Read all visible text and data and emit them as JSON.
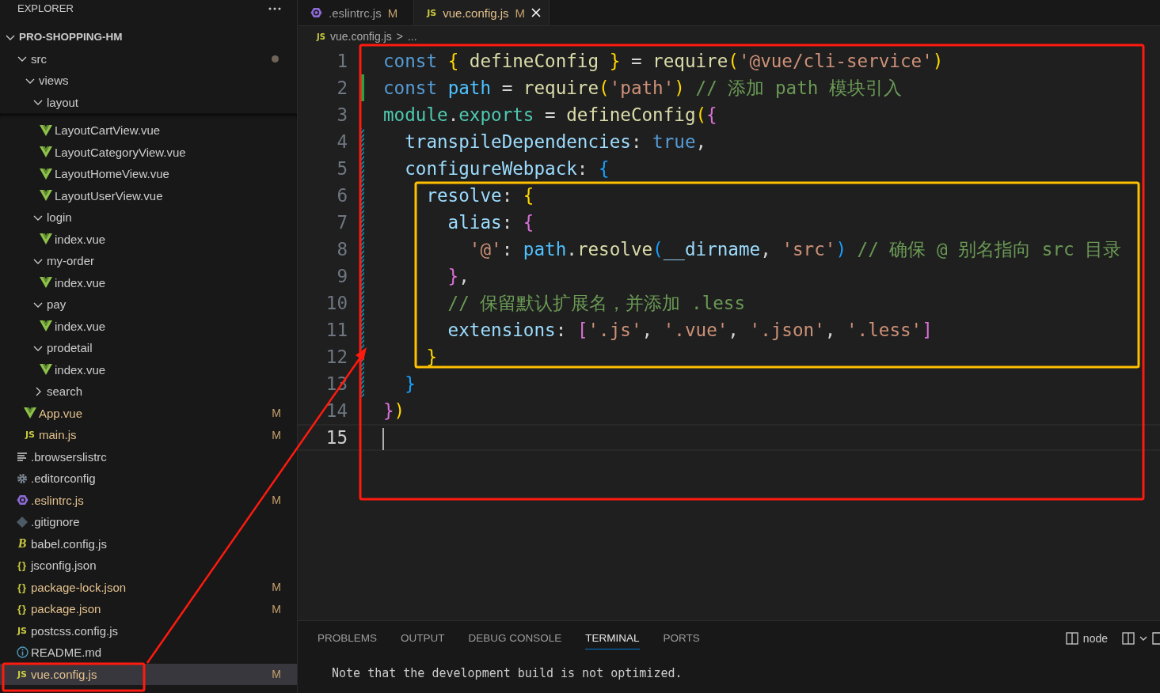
{
  "sidebar": {
    "title": "EXPLORER",
    "tree": {
      "label": "PRO-SHOPPING-HM",
      "kind": "folder",
      "expanded": true,
      "selected": false,
      "children": [
        {
          "label": "src",
          "kind": "folder",
          "expanded": true,
          "selected": false,
          "dot": true,
          "children": [
            {
              "label": "views",
              "kind": "folder",
              "expanded": true,
              "selected": false,
              "children": [
                {
                  "label": "layout",
                  "kind": "folder",
                  "expanded": true,
                  "selected": false,
                  "children": [
                    {
                      "label": "LayoutCartView.vue",
                      "kind": "vue",
                      "selected": false
                    },
                    {
                      "label": "LayoutCategoryView.vue",
                      "kind": "vue",
                      "selected": false
                    },
                    {
                      "label": "LayoutHomeView.vue",
                      "kind": "vue",
                      "selected": false
                    },
                    {
                      "label": "LayoutUserView.vue",
                      "kind": "vue",
                      "selected": false
                    }
                  ]
                },
                {
                  "label": "login",
                  "kind": "folder",
                  "expanded": true,
                  "selected": false,
                  "children": [
                    {
                      "label": "index.vue",
                      "kind": "vue",
                      "selected": false
                    }
                  ]
                },
                {
                  "label": "my-order",
                  "kind": "folder",
                  "expanded": true,
                  "selected": false,
                  "children": [
                    {
                      "label": "index.vue",
                      "kind": "vue",
                      "selected": false
                    }
                  ]
                },
                {
                  "label": "pay",
                  "kind": "folder",
                  "expanded": true,
                  "selected": false,
                  "children": [
                    {
                      "label": "index.vue",
                      "kind": "vue",
                      "selected": false
                    }
                  ]
                },
                {
                  "label": "prodetail",
                  "kind": "folder",
                  "expanded": true,
                  "selected": false,
                  "children": [
                    {
                      "label": "index.vue",
                      "kind": "vue",
                      "selected": false
                    }
                  ]
                },
                {
                  "label": "search",
                  "kind": "folder",
                  "expanded": false,
                  "selected": false
                }
              ]
            },
            {
              "label": "App.vue",
              "kind": "vue",
              "selected": false,
              "badge": "M"
            },
            {
              "label": "main.js",
              "kind": "js",
              "icon_label": "JS",
              "selected": false,
              "badge": "M"
            }
          ]
        },
        {
          "label": ".browserslistrc",
          "kind": "list",
          "selected": false
        },
        {
          "label": ".editorconfig",
          "kind": "gear",
          "selected": false
        },
        {
          "label": ".eslintrc.js",
          "kind": "eslint",
          "selected": false,
          "badge": "M"
        },
        {
          "label": ".gitignore",
          "kind": "git",
          "selected": false
        },
        {
          "label": "babel.config.js",
          "kind": "babel",
          "icon_label": "B",
          "selected": false
        },
        {
          "label": "jsconfig.json",
          "kind": "json",
          "icon_label": "{}",
          "selected": false
        },
        {
          "label": "package-lock.json",
          "kind": "json",
          "icon_label": "{}",
          "selected": false,
          "badge": "M"
        },
        {
          "label": "package.json",
          "kind": "json",
          "icon_label": "{}",
          "selected": false,
          "badge": "M"
        },
        {
          "label": "postcss.config.js",
          "kind": "js",
          "icon_label": "JS",
          "selected": false
        },
        {
          "label": "README.md",
          "kind": "info",
          "selected": false
        },
        {
          "label": "vue.config.js",
          "kind": "js",
          "icon_label": "JS",
          "selected": true,
          "badge": "M"
        }
      ]
    }
  },
  "tabs": [
    {
      "label": ".eslintrc.js",
      "kind": "eslint",
      "badge": "M",
      "selected": false
    },
    {
      "label": "vue.config.js",
      "kind": "js",
      "icon_label": "JS",
      "badge": "M",
      "selected": true
    }
  ],
  "breadcrumb": {
    "icon_label": "JS",
    "file": "vue.config.js",
    "separator": ">",
    "more": "..."
  },
  "code": [
    {
      "number": "1",
      "tokens": [
        {
          "kind": "kw",
          "text": "const "
        },
        {
          "kind": "b1",
          "text": "{"
        },
        {
          "kind": "fn",
          "text": " defineConfig "
        },
        {
          "kind": "b1",
          "text": "}"
        },
        {
          "kind": "p",
          "text": " = "
        },
        {
          "kind": "fn",
          "text": "require"
        },
        {
          "kind": "b1",
          "text": "("
        },
        {
          "kind": "str",
          "text": "'@vue/cli-service'"
        },
        {
          "kind": "b1",
          "text": ")"
        }
      ]
    },
    {
      "number": "2",
      "kind": "added",
      "tokens": [
        {
          "kind": "kw",
          "text": "const "
        },
        {
          "kind": "cv",
          "text": "path"
        },
        {
          "kind": "p",
          "text": " = "
        },
        {
          "kind": "fn",
          "text": "require"
        },
        {
          "kind": "b1",
          "text": "("
        },
        {
          "kind": "str",
          "text": "'path'"
        },
        {
          "kind": "b1",
          "text": ")"
        },
        {
          "kind": "cmt",
          "text": " // 添加 path 模块引入"
        }
      ]
    },
    {
      "number": "3",
      "tokens": [
        {
          "kind": "obj",
          "text": "module"
        },
        {
          "kind": "p",
          "text": "."
        },
        {
          "kind": "obj",
          "text": "exports"
        },
        {
          "kind": "p",
          "text": " = "
        },
        {
          "kind": "fn",
          "text": "defineConfig"
        },
        {
          "kind": "b1",
          "text": "("
        },
        {
          "kind": "b2",
          "text": "{"
        }
      ]
    },
    {
      "number": "4",
      "kind": "modified",
      "tokens": [
        {
          "kind": "var",
          "text": "  transpileDependencies"
        },
        {
          "kind": "p",
          "text": ": "
        },
        {
          "kind": "kw",
          "text": "true"
        },
        {
          "kind": "p",
          "text": ","
        }
      ]
    },
    {
      "number": "5",
      "kind": "modified",
      "tokens": [
        {
          "kind": "var",
          "text": "  configureWebpack"
        },
        {
          "kind": "p",
          "text": ": "
        },
        {
          "kind": "b3",
          "text": "{"
        }
      ]
    },
    {
      "number": "6",
      "kind": "modified",
      "tokens": [
        {
          "kind": "var",
          "text": "    resolve"
        },
        {
          "kind": "p",
          "text": ": "
        },
        {
          "kind": "b1",
          "text": "{"
        }
      ]
    },
    {
      "number": "7",
      "kind": "modified",
      "tokens": [
        {
          "kind": "var",
          "text": "      alias"
        },
        {
          "kind": "p",
          "text": ": "
        },
        {
          "kind": "b2",
          "text": "{"
        }
      ]
    },
    {
      "number": "8",
      "kind": "modified",
      "tokens": [
        {
          "kind": "str",
          "text": "        '@'"
        },
        {
          "kind": "p",
          "text": ": "
        },
        {
          "kind": "cv",
          "text": "path"
        },
        {
          "kind": "p",
          "text": "."
        },
        {
          "kind": "fn",
          "text": "resolve"
        },
        {
          "kind": "b3",
          "text": "("
        },
        {
          "kind": "var",
          "text": "__dirname"
        },
        {
          "kind": "p",
          "text": ", "
        },
        {
          "kind": "str",
          "text": "'src'"
        },
        {
          "kind": "b3",
          "text": ")"
        },
        {
          "kind": "cmt",
          "text": " // 确保 @ 别名指向 src 目录"
        }
      ]
    },
    {
      "number": "9",
      "kind": "modified",
      "tokens": [
        {
          "kind": "b2",
          "text": "      }"
        },
        {
          "kind": "p",
          "text": ","
        }
      ]
    },
    {
      "number": "10",
      "kind": "modified",
      "tokens": [
        {
          "kind": "cmt",
          "text": "      // 保留默认扩展名，并添加 .less"
        }
      ]
    },
    {
      "number": "11",
      "kind": "modified",
      "tokens": [
        {
          "kind": "var",
          "text": "      extensions"
        },
        {
          "kind": "p",
          "text": ": "
        },
        {
          "kind": "b2",
          "text": "["
        },
        {
          "kind": "str",
          "text": "'.js'"
        },
        {
          "kind": "p",
          "text": ", "
        },
        {
          "kind": "str",
          "text": "'.vue'"
        },
        {
          "kind": "p",
          "text": ", "
        },
        {
          "kind": "str",
          "text": "'.json'"
        },
        {
          "kind": "p",
          "text": ", "
        },
        {
          "kind": "str",
          "text": "'.less'"
        },
        {
          "kind": "b2",
          "text": "]"
        }
      ]
    },
    {
      "number": "12",
      "kind": "modified",
      "tokens": [
        {
          "kind": "b1",
          "text": "    }"
        }
      ]
    },
    {
      "number": "13",
      "kind": "modified",
      "tokens": [
        {
          "kind": "b3",
          "text": "  }"
        }
      ]
    },
    {
      "number": "14",
      "tokens": [
        {
          "kind": "b2",
          "text": "}"
        },
        {
          "kind": "b1",
          "text": ")"
        }
      ]
    },
    {
      "number": "15",
      "current": true
    }
  ],
  "panel": {
    "tabs": [
      {
        "label": "PROBLEMS",
        "selected": false
      },
      {
        "label": "OUTPUT",
        "selected": false
      },
      {
        "label": "DEBUG CONSOLE",
        "selected": false
      },
      {
        "label": "TERMINAL",
        "selected": true
      },
      {
        "label": "PORTS",
        "selected": false
      }
    ],
    "terminal_name": "node",
    "terminal_text": "Note that the development build is not optimized."
  }
}
